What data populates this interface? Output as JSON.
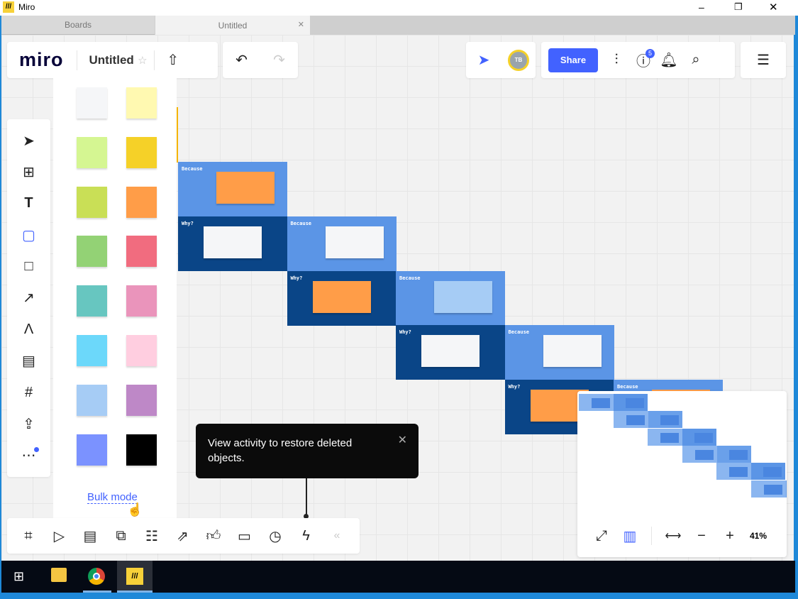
{
  "window": {
    "title": "Miro",
    "minimize": "–",
    "restore": "❐",
    "close": "✕"
  },
  "tabs": [
    {
      "label": "Boards"
    },
    {
      "label": "Untitled",
      "close": "✕"
    }
  ],
  "header": {
    "logo": "miro",
    "board_name": "Untitled",
    "share_label": "Share",
    "help_badge": "5",
    "avatar_initials": "TB"
  },
  "colors": {
    "accent": "#4262ff",
    "frame_light": "#5b95e6",
    "frame_dark": "#0a4587"
  },
  "palette": {
    "swatches": [
      "#f5f6f8",
      "#fff9b1",
      "#d5f692",
      "#f5d128",
      "#c9df56",
      "#ff9d48",
      "#93d275",
      "#f16c7f",
      "#67c6c0",
      "#ea94bb",
      "#6cd8fa",
      "#ffcee0",
      "#a6ccf5",
      "#be88c7",
      "#7b92ff",
      "#000000"
    ],
    "bulk_mode": "Bulk mode"
  },
  "frames": [
    {
      "label": "Because",
      "dark": false,
      "sticky": "#ff9d48"
    },
    {
      "label": "Why?",
      "dark": true,
      "sticky": "#f5f6f8"
    },
    {
      "label": "Because",
      "dark": false,
      "sticky": "#f5f6f8"
    },
    {
      "label": "Why?",
      "dark": true,
      "sticky": "#ff9d48"
    },
    {
      "label": "Because",
      "dark": false,
      "sticky": "#a6ccf5"
    },
    {
      "label": "Why?",
      "dark": true,
      "sticky": "#f5f6f8"
    },
    {
      "label": "Because",
      "dark": false,
      "sticky": "#f5f6f8"
    },
    {
      "label": "Why?",
      "dark": true,
      "sticky": "#ff9d48"
    },
    {
      "label": "Because",
      "dark": false,
      "sticky": "#ff9d48"
    }
  ],
  "toast": {
    "message": "View activity to restore deleted objects.",
    "close": "✕"
  },
  "zoom": {
    "level": "41%",
    "minus": "−",
    "plus": "+"
  },
  "bottom_toolbar": {
    "collapse": "«"
  }
}
